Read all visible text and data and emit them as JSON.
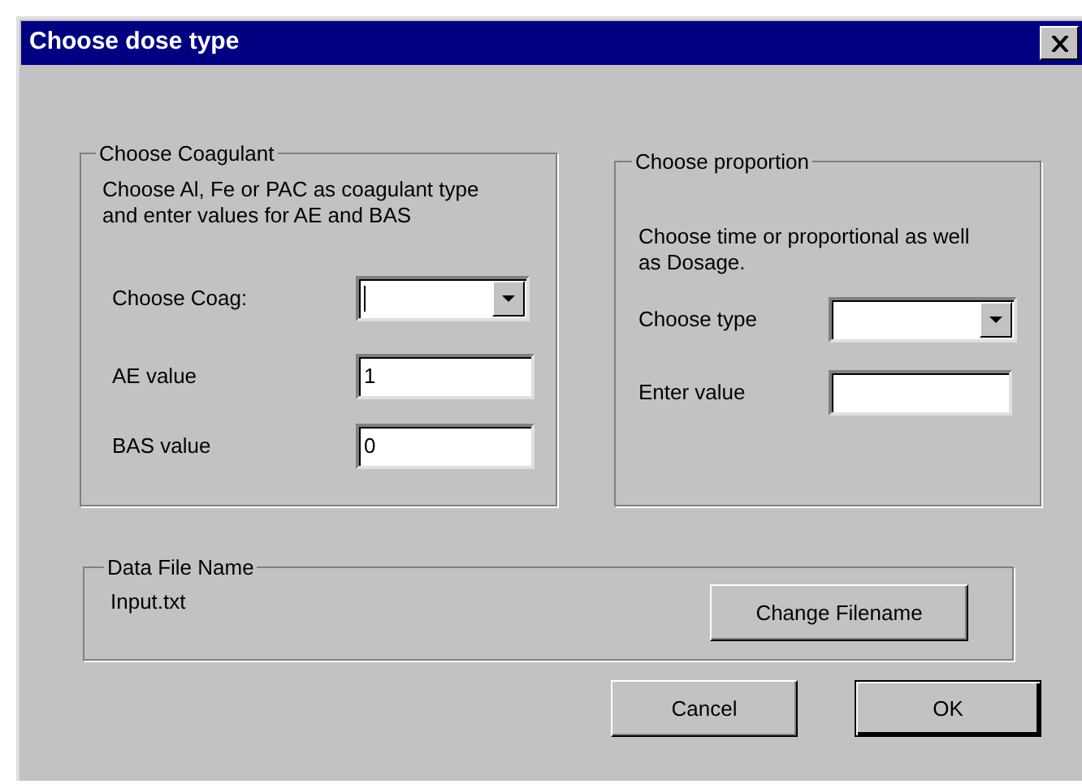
{
  "window": {
    "title": "Choose dose type"
  },
  "coagulant_group": {
    "legend": "Choose Coagulant",
    "description": "Choose Al, Fe or PAC as coagulant type and enter values for AE and BAS",
    "fields": [
      {
        "kind": "combo",
        "label": "Choose Coag:",
        "focused": true
      },
      {
        "kind": "text",
        "label": "AE value",
        "value": "1",
        "focused": false
      },
      {
        "kind": "text",
        "label": "BAS value",
        "value": "0",
        "focused": false
      }
    ]
  },
  "proportion_group": {
    "legend": "Choose proportion",
    "description": "Choose time or proportional as well as Dosage.",
    "fields": [
      {
        "kind": "combo",
        "label": "Choose type",
        "focused": false
      },
      {
        "kind": "text",
        "label": "Enter value",
        "focused": false
      }
    ]
  },
  "data_file_group": {
    "legend": "Data File Name",
    "filename": "Input.txt",
    "button": "Change Filename"
  },
  "buttons": [
    {
      "label": "Cancel",
      "default": false
    },
    {
      "label": "OK",
      "default": true
    }
  ]
}
